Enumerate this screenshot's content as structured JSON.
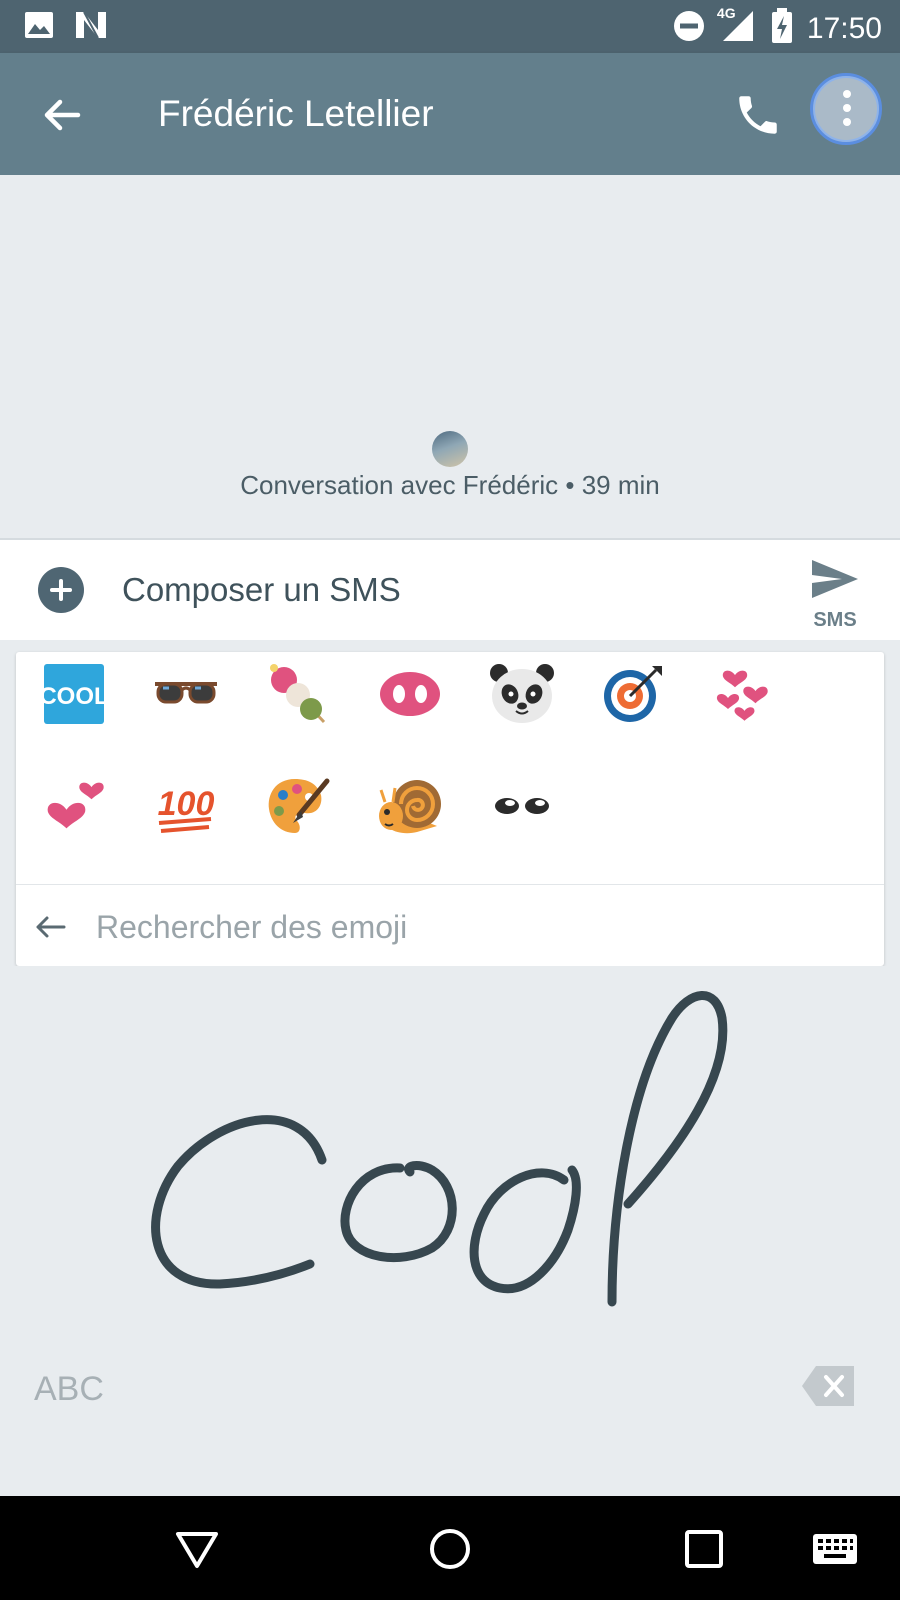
{
  "status_bar": {
    "time": "17:50",
    "network": "4G",
    "icons": [
      "image-icon",
      "n-icon",
      "do-not-disturb-icon",
      "signal-icon",
      "battery-charging-icon"
    ]
  },
  "app_bar": {
    "title": "Frédéric Letellier",
    "icons": [
      "back-arrow-icon",
      "phone-icon",
      "contact-avatar"
    ]
  },
  "conversation": {
    "caption": "Conversation avec Frédéric • 39 min"
  },
  "compose": {
    "placeholder": "Composer un SMS",
    "send_label": "SMS"
  },
  "emoji_panel": {
    "emojis": [
      "cool-emoji",
      "sunglasses-emoji",
      "dango-emoji",
      "pig-nose-emoji",
      "panda-emoji",
      "direct-hit-emoji",
      "revolving-hearts-emoji",
      "two-hearts-emoji",
      "hundred-points-emoji",
      "artist-palette-emoji",
      "snail-emoji",
      "eyes-emoji"
    ],
    "search_placeholder": "Rechercher des emoji"
  },
  "handwriting": {
    "text": "Cool",
    "switch_label": "ABC"
  },
  "nav_bar": {
    "icons": [
      "back-triangle-icon",
      "home-circle-icon",
      "recents-square-icon",
      "keyboard-icon"
    ]
  },
  "colors": {
    "status_bar": "#4e6470",
    "app_bar": "#637f8c",
    "background": "#e8ecef",
    "ink": "#37474f",
    "accent_pink": "#e0527f"
  }
}
